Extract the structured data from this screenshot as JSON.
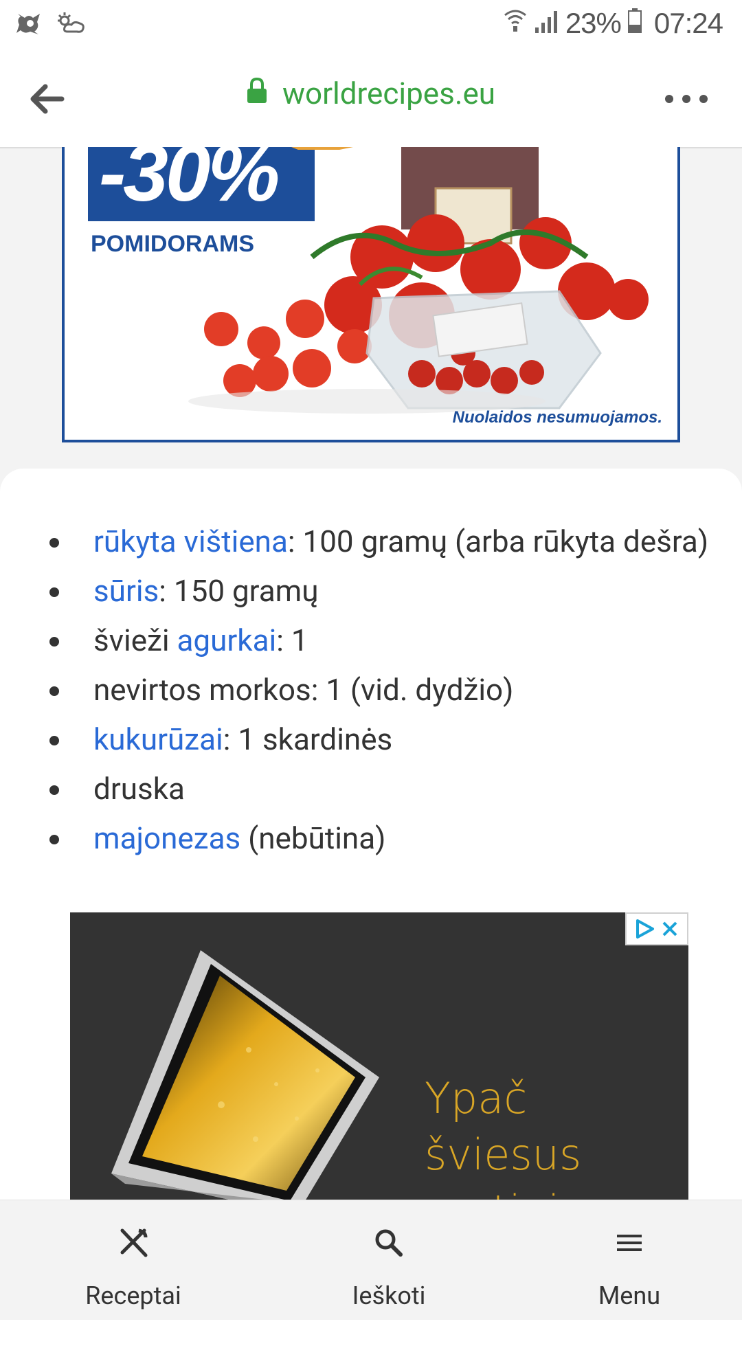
{
  "status_bar": {
    "battery_percent": "23%",
    "time": "07:24",
    "icons": [
      "notification-app-icon",
      "weather-icon",
      "wifi-icon",
      "signal-icon",
      "battery-icon"
    ]
  },
  "browser": {
    "url": "worldrecipes.eu",
    "secure": true,
    "accent_color": "#3aa343"
  },
  "ad_top": {
    "discount": "-30%",
    "product": "POMIDORAMS",
    "footer": "Nuolaidos nesumuojamos."
  },
  "ingredients": [
    {
      "link": "rūkyta vištiena",
      "text_after": ": 100 gramų (arba rūkyta dešra)"
    },
    {
      "link": "sūris",
      "text_after": ": 150 gramų"
    },
    {
      "text_before": "švieži ",
      "link": "agurkai",
      "text_after": ": 1"
    },
    {
      "text_before": "nevirtos morkos: 1 (vid. dydžio)"
    },
    {
      "link": "kukurūzai",
      "text_after": ": 1 skardinės"
    },
    {
      "text_before": "druska"
    },
    {
      "link": "majonezas",
      "text_after": " (nebūtina)"
    }
  ],
  "ad_bottom": {
    "headline": "Ypač šviesus matinis"
  },
  "bottom_nav": {
    "recipes_label": "Receptai",
    "search_label": "Ieškoti",
    "menu_label": "Menu"
  },
  "colors": {
    "link": "#2a6ad6",
    "ad_gold": "#d9a626",
    "ad_blue": "#1d4e9a"
  }
}
